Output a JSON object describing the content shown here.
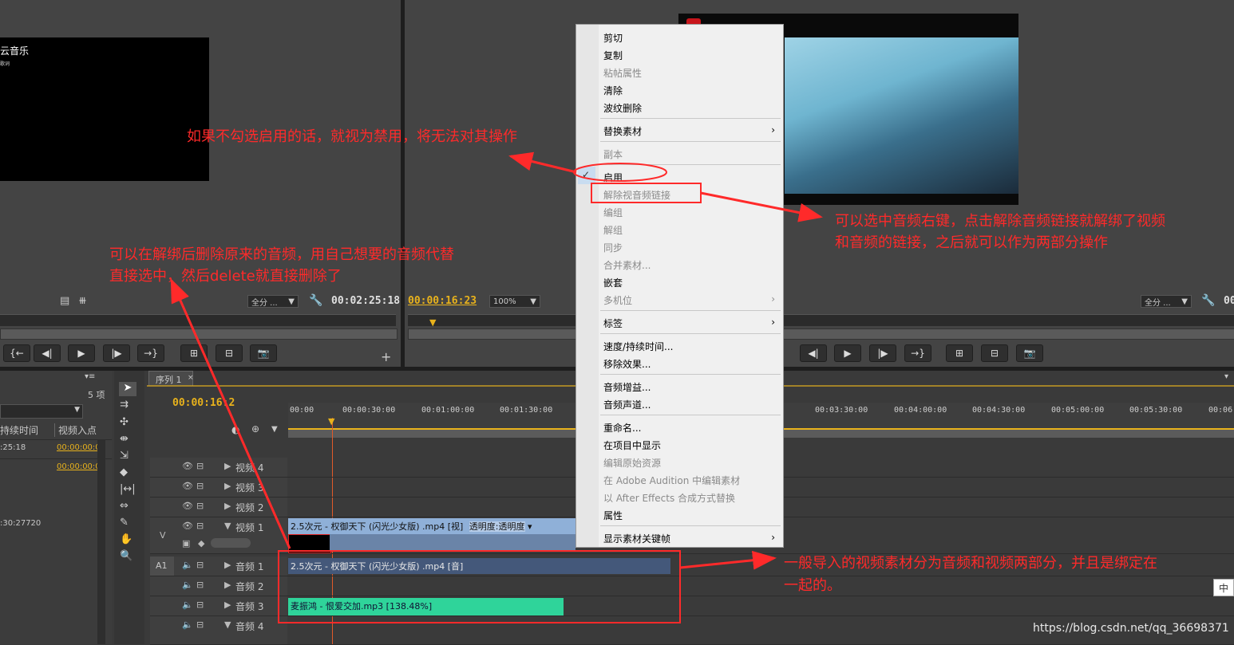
{
  "source_monitor": {
    "overlay_text": "云音乐",
    "overlay_sub": "歌词",
    "zoom_label": "全分 ...",
    "timecode": "00:02:25:18"
  },
  "program_monitor": {
    "current_time": "00:00:16:23",
    "zoom_label": "100%",
    "right_zoom_label": "全分 ...",
    "right_timecode": "00"
  },
  "project_panel": {
    "item_count": "5 项",
    "col_duration": "持续时间",
    "col_in": "视频入点",
    "rows": [
      {
        "duration": ":25:18",
        "in_point": "00:00:00:0"
      },
      {
        "duration": "",
        "in_point": "00:00:00:0"
      },
      {
        "duration": ":30:27720",
        "in_point": ""
      }
    ]
  },
  "timeline": {
    "tab_label": "序列 1",
    "current_time": "00:00:16:2",
    "ruler_ticks": [
      "00:00",
      "00:00:30:00",
      "00:01:00:00",
      "00:01:30:00",
      "00:03:30:00",
      "00:04:00:00",
      "00:04:30:00",
      "00:05:00:00",
      "00:05:30:00",
      "00:06:"
    ],
    "video_tracks": [
      "视频 4",
      "视频 3",
      "视频 2",
      "视频 1"
    ],
    "audio_tracks": [
      "音频 1",
      "音频 2",
      "音频 3",
      "音频 4"
    ],
    "v_label": "V",
    "a_label": "A1",
    "video_clip": "2.5次元 - 权御天下 (闪光少女版) .mp4 [视]",
    "video_clip_fx": "透明度:透明度",
    "audio_clip": "2.5次元 - 权御天下 (闪光少女版) .mp4 [音]",
    "music_clip": "麦振鸿 - 恨爱交加.mp3 [138.48%]"
  },
  "context_menu": {
    "items": [
      {
        "label": "剪切",
        "disabled": false
      },
      {
        "label": "复制",
        "disabled": false
      },
      {
        "label": "粘帖属性",
        "disabled": true
      },
      {
        "label": "清除",
        "disabled": false
      },
      {
        "label": "波纹删除",
        "disabled": false
      },
      {
        "label": "替换素材",
        "disabled": false,
        "submenu": true
      },
      {
        "label": "副本",
        "disabled": true
      },
      {
        "label": "启用",
        "disabled": false,
        "checked": true
      },
      {
        "label": "解除视音频链接",
        "disabled": true
      },
      {
        "label": "编组",
        "disabled": true
      },
      {
        "label": "解组",
        "disabled": true
      },
      {
        "label": "同步",
        "disabled": true
      },
      {
        "label": "合并素材...",
        "disabled": true
      },
      {
        "label": "嵌套",
        "disabled": false
      },
      {
        "label": "多机位",
        "disabled": true,
        "submenu": true
      },
      {
        "label": "标签",
        "disabled": false,
        "submenu": true
      },
      {
        "label": "速度/持续时间...",
        "disabled": false
      },
      {
        "label": "移除效果...",
        "disabled": false
      },
      {
        "label": "音频增益...",
        "disabled": false
      },
      {
        "label": "音频声道...",
        "disabled": false
      },
      {
        "label": "重命名...",
        "disabled": false
      },
      {
        "label": "在项目中显示",
        "disabled": false
      },
      {
        "label": "编辑原始资源",
        "disabled": true
      },
      {
        "label": "在 Adobe Audition 中编辑素材",
        "disabled": true
      },
      {
        "label": "以 After Effects 合成方式替换",
        "disabled": true
      },
      {
        "label": "属性",
        "disabled": false
      },
      {
        "label": "显示素材关键帧",
        "disabled": false,
        "submenu": true
      }
    ]
  },
  "annotations": {
    "enable_note": "如果不勾选启用的话，就视为禁用，将无法对其操作",
    "unlink_note_1": "可以选中音频右键，点击解除音频链接就解绑了视频",
    "unlink_note_2": "和音频的链接，之后就可以作为两部分操作",
    "delete_note_1": "可以在解绑后删除原来的音频，用自己想要的音频代替",
    "delete_note_2": "直接选中，然后delete就直接删除了",
    "linked_note_1": "一般导入的视频素材分为音频和视频两部分，并且是绑定在",
    "linked_note_2": "一起的。"
  },
  "ime_indicator": "中",
  "watermark": "https://blog.csdn.net/qq_36698371",
  "colors": {
    "timecode_yellow": "#e8b21c",
    "annotation_red": "#ff2a2a",
    "video_clip": "#8fb0d8",
    "audio_clip": "#44587a",
    "music_clip": "#2fd49a"
  }
}
